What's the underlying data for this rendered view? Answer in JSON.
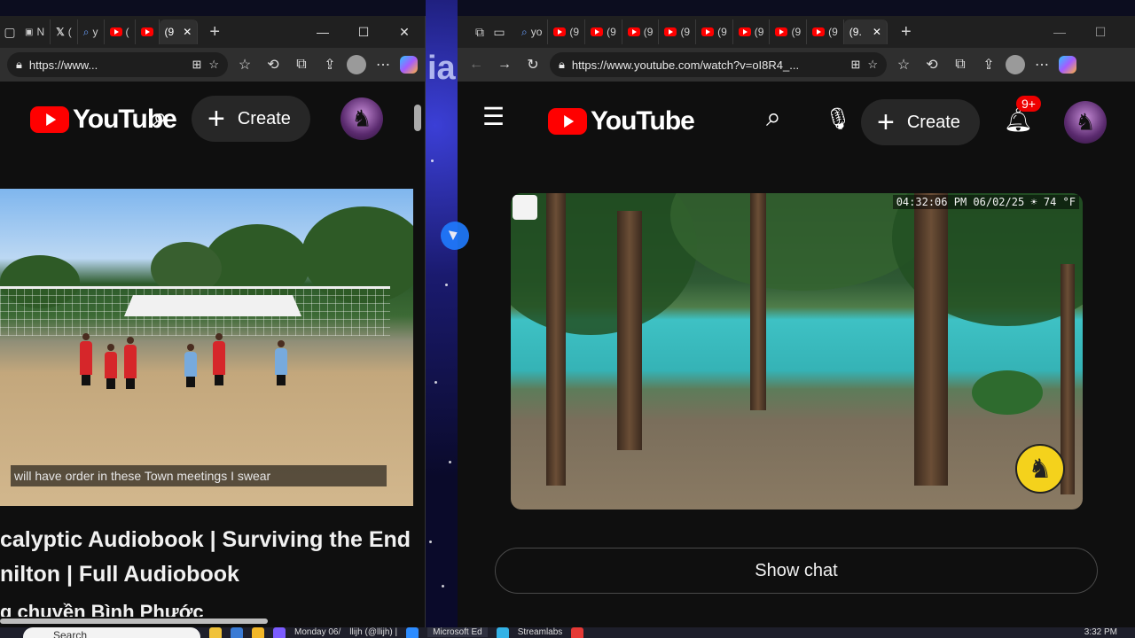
{
  "left_window": {
    "tabs": [
      {
        "label": "N",
        "icon": "tab-actions-icon"
      },
      {
        "label": "(",
        "icon": "x-icon"
      },
      {
        "label": "y",
        "icon": "search-icon"
      },
      {
        "label": "(",
        "icon": "youtube-icon"
      },
      {
        "label": "(9",
        "icon": "youtube-icon",
        "active": true
      }
    ],
    "url": "https://www...",
    "youtube": {
      "logo_text": "YouTube",
      "create_label": "Create"
    },
    "video": {
      "caption": "will have order in these Town meetings I swear"
    },
    "title_line1": "calyptic Audiobook | Surviving the End",
    "title_line2": "nilton | Full Audiobook",
    "subtitle": "g chuyền Bình Phước"
  },
  "wallpaper_text": "ia",
  "right_window": {
    "tabs": [
      {
        "label": "yo",
        "icon": "search-icon"
      },
      {
        "label": "(9",
        "icon": "youtube-icon"
      },
      {
        "label": "(9",
        "icon": "youtube-icon"
      },
      {
        "label": "(9",
        "icon": "youtube-icon"
      },
      {
        "label": "(9",
        "icon": "youtube-icon"
      },
      {
        "label": "(9",
        "icon": "youtube-icon"
      },
      {
        "label": "(9",
        "icon": "youtube-icon"
      },
      {
        "label": "(9",
        "icon": "youtube-icon"
      },
      {
        "label": "(9",
        "icon": "youtube-icon"
      },
      {
        "label": "(9.",
        "icon": "youtube-icon",
        "active": true
      }
    ],
    "url": "https://www.youtube.com/watch?v=oI8R4_...",
    "youtube": {
      "logo_text": "YouTube",
      "create_label": "Create",
      "notification_badge": "9+"
    },
    "video": {
      "timestamp": "04:32:06 PM 06/02/25 ☀ 74 °F"
    },
    "show_chat_label": "Show chat"
  },
  "taskbar": {
    "search_placeholder": "Search",
    "items": [
      "Monday 06/",
      "llijh (@llijh) |",
      "Microsoft Ed",
      "Streamlabs"
    ],
    "clock": "3:32 PM"
  },
  "colors": {
    "youtube_red": "#ff0000",
    "page_bg": "#0f0f0f",
    "chip_bg": "#272727"
  }
}
